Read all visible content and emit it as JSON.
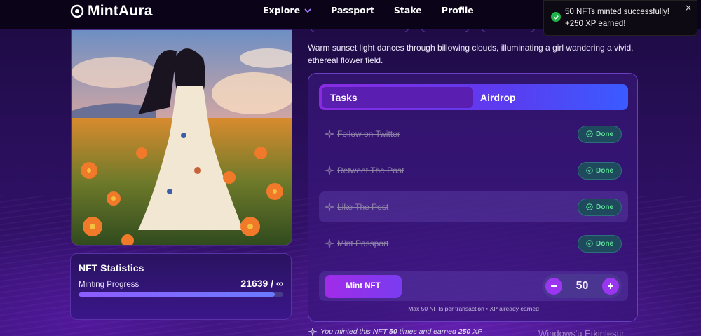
{
  "header": {
    "brand": "MintAura",
    "nav": [
      "Explore",
      "Passport",
      "Stake",
      "Profile"
    ]
  },
  "toast": {
    "line1": "50 NFTs minted successfully!",
    "line2": "+250 XP earned!",
    "close": "×"
  },
  "description": "Warm sunset light dances through billowing clouds, illuminating a girl wandering a vivid, ethereal flower field.",
  "stats": {
    "title": "NFT Statistics",
    "progress_label": "Minting Progress",
    "progress_value": "21639 / ∞",
    "progress_fill_percent": 96
  },
  "tabs": {
    "active": "Tasks",
    "other": "Airdrop"
  },
  "tasks": [
    {
      "label": "Follow on Twitter",
      "status": "Done"
    },
    {
      "label": "Retweet The Post",
      "status": "Done"
    },
    {
      "label": "Like The Post",
      "status": "Done"
    },
    {
      "label": "Mint Passport",
      "status": "Done"
    }
  ],
  "mint": {
    "button": "Mint NFT",
    "quantity": "50",
    "note": "Max 50 NFTs per transaction • XP already earned"
  },
  "footer": {
    "prefix": "You minted this NFT ",
    "times": "50",
    "middle": " times and earned ",
    "xp": "250",
    "suffix": " XP"
  },
  "watermark": "Windows'u Etkinleştir",
  "colors": {
    "accent": "#8a2be2",
    "done_green": "#5fe39a",
    "toast_check": "#22b34a"
  }
}
